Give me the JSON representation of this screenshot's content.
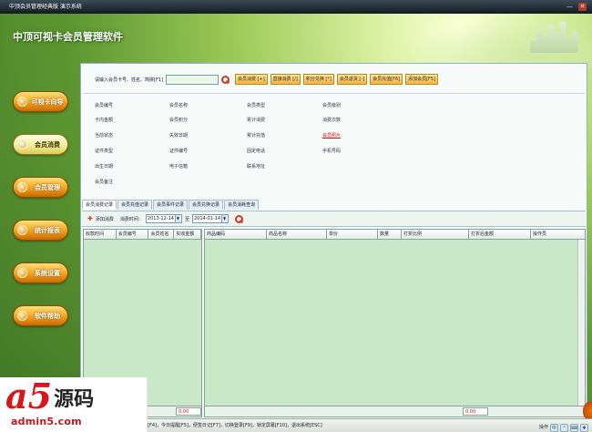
{
  "window": {
    "title": "中顶会员管理经典版 演示系统",
    "minimize": "—",
    "close": "✕"
  },
  "app_title": "中顶可视卡会员管理软件",
  "nav": [
    {
      "label": "可视卡向导"
    },
    {
      "label": "会员消费"
    },
    {
      "label": "会员管理"
    },
    {
      "label": "统计报表"
    },
    {
      "label": "系统设置"
    },
    {
      "label": "软件帮助"
    }
  ],
  "search": {
    "label": "请输入会员卡号、姓名、简拼[F1]",
    "value": "",
    "buttons": [
      "会员消费 [+]",
      "直接消费 [/]",
      "积分兑换 [*]",
      "会员退货 [-]",
      "会员充值[F6]",
      "添加会员[F5]"
    ]
  },
  "info": {
    "col1": [
      "会员编号",
      "卡内金额",
      "当前状态",
      "证件类型",
      "出生日期",
      "会员备注"
    ],
    "col2": [
      "会员名称",
      "会员积分",
      "失效日期",
      "证件编号",
      "电子信箱"
    ],
    "col3": [
      "会员类型",
      "累计消费",
      "累计充值",
      "固定电话",
      "联系地址"
    ],
    "col4": [
      "会员级别",
      "消费次数",
      "会员照片",
      "手机号码"
    ]
  },
  "tabs": [
    "会员消费记录",
    "会员充值记录",
    "会员事件记录",
    "会员兑换记录",
    "会员消耗查询"
  ],
  "toolbar": {
    "add_label": "添加消费",
    "time_label": "消费时间：",
    "start_date": "2013-12-14",
    "to_label": "至",
    "end_date": "2014-01-14"
  },
  "left_grid": {
    "headers": [
      "收款时间",
      "会员编号",
      "会员姓名",
      "实收金额"
    ],
    "total": "0.00"
  },
  "right_grid": {
    "headers": [
      "商品编码",
      "商品名称",
      "单价",
      "数量",
      "打折比例",
      "打折后金额",
      "操作员"
    ],
    "total": "0.00"
  },
  "status_bar": {
    "text": "[F4]，今日提醒[F5]，便签日记[F7]，切换登录[F9]，锁定屏幕[F10]，退出系统[ESC]",
    "ime_label": "操作",
    "ime_mode": "中"
  },
  "watermark": {
    "brand": "a5",
    "brand_text": "源码",
    "url": "admin5.com"
  },
  "colors": {
    "accent": "#f0a11c",
    "active_nav": "#f4ec9c",
    "grid_bg": "#c8e8c8",
    "panel_border": "#8db3cf",
    "total_text": "#dd1111"
  }
}
